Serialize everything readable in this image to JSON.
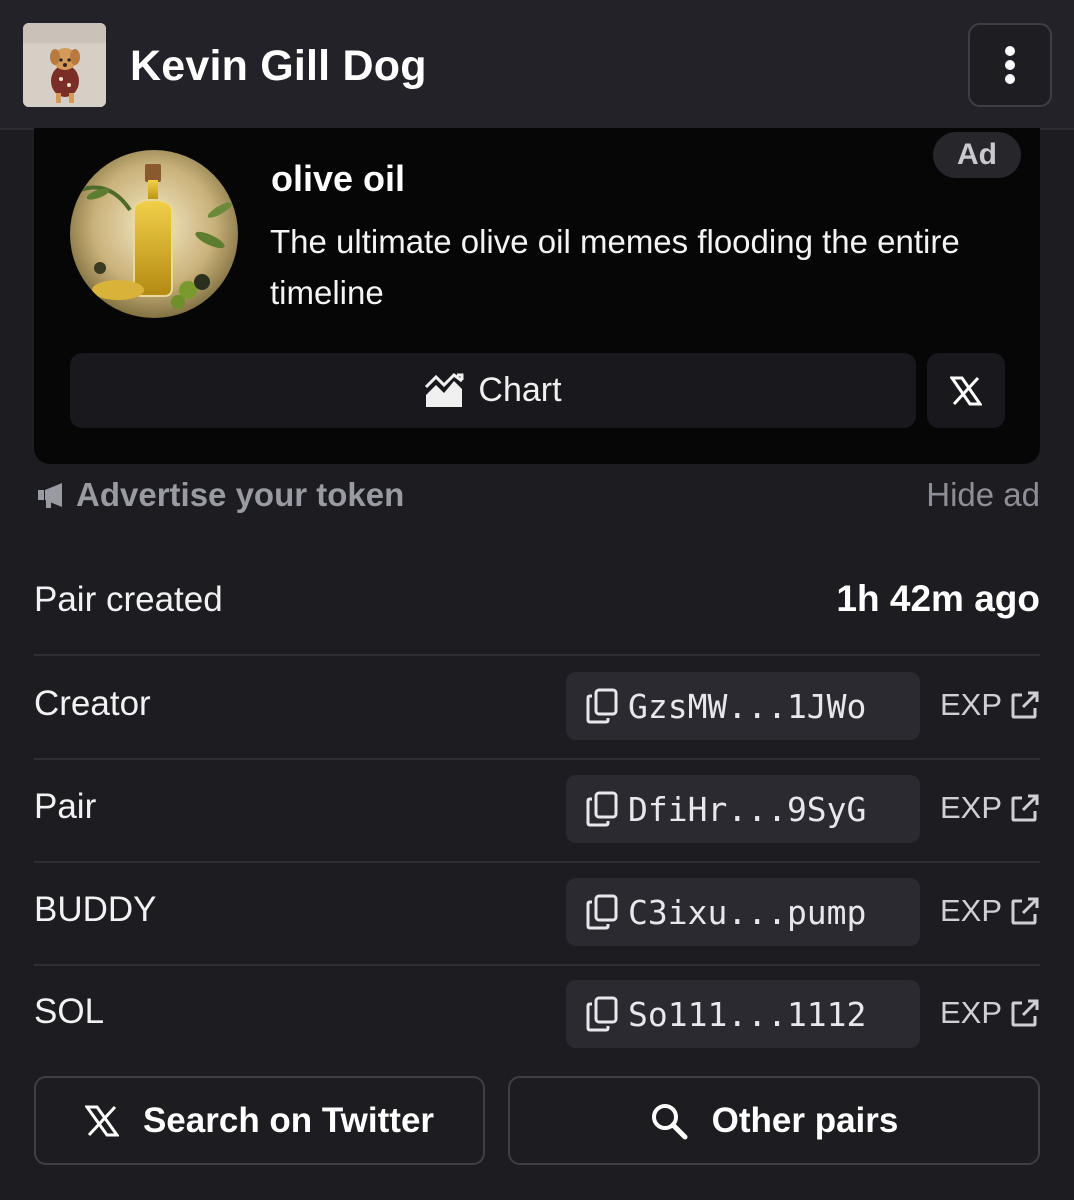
{
  "header": {
    "token_name": "Kevin Gill Dog",
    "menu_icon": "kebab-menu-icon"
  },
  "ad": {
    "badge": "Ad",
    "name": "olive oil",
    "description": "The ultimate olive oil memes flooding the entire timeline",
    "chart_label": "Chart",
    "chart_icon": "chart-icon",
    "x_icon": "x-logo-icon"
  },
  "advertise": {
    "label": "Advertise your token",
    "icon": "megaphone-icon",
    "hide_label": "Hide ad"
  },
  "pair_created": {
    "label": "Pair created",
    "value": "1h 42m ago"
  },
  "addresses": [
    {
      "label": "Creator",
      "address": "GzsMW...1JWo",
      "exp": "EXP"
    },
    {
      "label": "Pair",
      "address": "DfiHr...9SyG",
      "exp": "EXP"
    },
    {
      "label": "BUDDY",
      "address": "C3ixu...pump",
      "exp": "EXP"
    },
    {
      "label": "SOL",
      "address": "So111...1112",
      "exp": "EXP"
    }
  ],
  "actions": {
    "search_twitter": "Search on Twitter",
    "other_pairs": "Other pairs"
  },
  "colors": {
    "background": "#1c1c21",
    "header": "#222228",
    "ad_card": "#060607",
    "chip": "#2a2a30"
  }
}
